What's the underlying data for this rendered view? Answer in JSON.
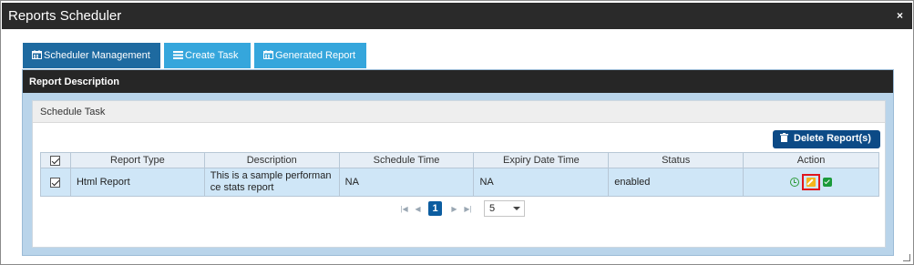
{
  "window": {
    "title": "Reports Scheduler",
    "close_label": "×"
  },
  "tabs": [
    {
      "label": "Scheduler Management",
      "icon": "calendar-icon",
      "active": true
    },
    {
      "label": "Create Task",
      "icon": "list-icon",
      "active": false
    },
    {
      "label": "Generated Report",
      "icon": "calendar-icon",
      "active": false
    }
  ],
  "panel": {
    "title": "Report Description"
  },
  "section": {
    "title": "Schedule Task"
  },
  "toolbar": {
    "delete_label": "Delete Report(s)",
    "delete_icon": "trash-icon"
  },
  "table": {
    "headers": [
      "Report Type",
      "Description",
      "Schedule Time",
      "Expiry Date Time",
      "Status",
      "Action"
    ],
    "rows": [
      {
        "checked": true,
        "report_type": "Html Report",
        "description_line1": "This is a sample performan",
        "description_line2": "ce stats report",
        "schedule_time": "NA",
        "expiry_date_time": "NA",
        "status": "enabled",
        "actions": [
          "clock-icon",
          "edit-icon",
          "check-icon"
        ]
      }
    ]
  },
  "pager": {
    "current_page": "1",
    "page_size": "5"
  },
  "colors": {
    "titlebar": "#2a2a2a",
    "tab_active": "#1e6aa0",
    "tab_inactive": "#35a6dc",
    "accent_button": "#0c4a86",
    "row_bg": "#cfe6f7"
  }
}
